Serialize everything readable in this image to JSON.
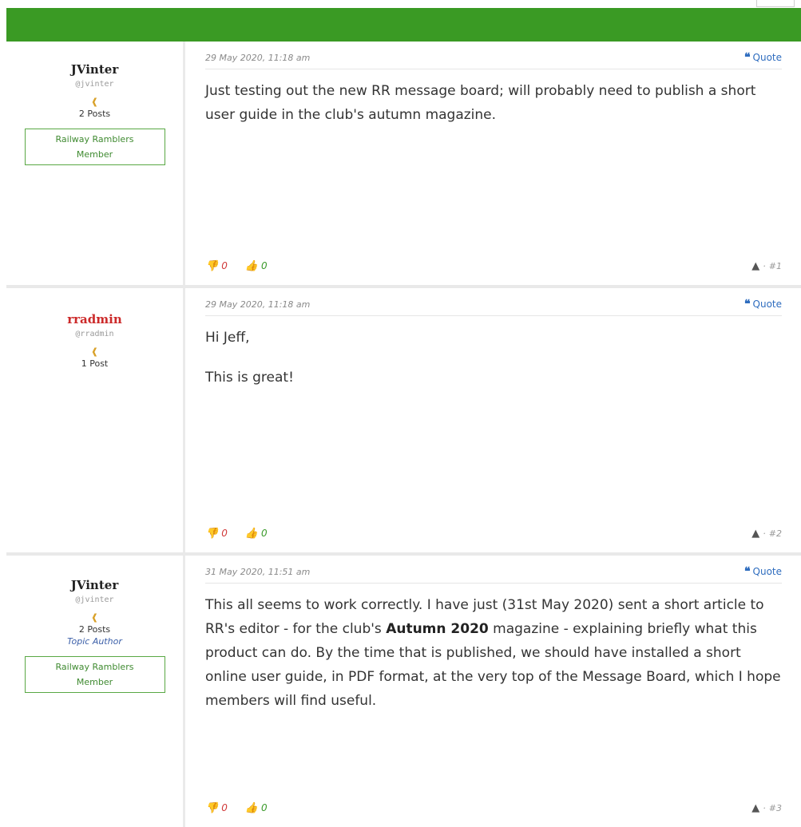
{
  "posts": [
    {
      "author": "JVinter",
      "handle": "@jvinter",
      "post_count": "2 Posts",
      "topic_author": "",
      "badge": [
        "Railway Ramblers",
        "Member"
      ],
      "date": "29 May 2020, 11:18 am",
      "quote_label": "Quote",
      "body": [
        "Just testing out the new RR message board; will probably need to publish a short user guide in the club's autumn magazine."
      ],
      "dislikes": "0",
      "likes": "0",
      "number": "#1"
    },
    {
      "author": "rradmin",
      "handle": "@rradmin",
      "post_count": "1 Post",
      "topic_author": "",
      "badge": [],
      "date": "29 May 2020, 11:18 am",
      "quote_label": "Quote",
      "body": [
        "Hi Jeff,",
        "This is great!"
      ],
      "dislikes": "0",
      "likes": "0",
      "number": "#2"
    },
    {
      "author": "JVinter",
      "handle": "@jvinter",
      "post_count": "2 Posts",
      "topic_author": "Topic Author",
      "badge": [
        "Railway Ramblers",
        "Member"
      ],
      "date": "31 May 2020, 11:51 am",
      "quote_label": "Quote",
      "body_parts": {
        "before": "This all seems to work correctly.  I have just (31st May 2020) sent a short article to RR's editor - for the club's ",
        "bold": "Autumn 2020",
        "after": " magazine - explaining briefly what this product can do.  By the time that is published, we should have installed a short online user guide, in PDF format, at the very top of the Message Board, which I hope members will find useful."
      },
      "dislikes": "0",
      "likes": "0",
      "number": "#3"
    }
  ],
  "colors": {
    "header_bar": "#3a9a24",
    "admin_name": "#cc2a2a",
    "badge_border": "#59a844",
    "quote_link": "#2f6dbf"
  },
  "icons": {
    "quote": "quote-icon",
    "thumbs_down": "thumbs-down-icon",
    "thumbs_up": "thumbs-up-icon",
    "report": "warning-icon",
    "rank": "rank-icon"
  }
}
